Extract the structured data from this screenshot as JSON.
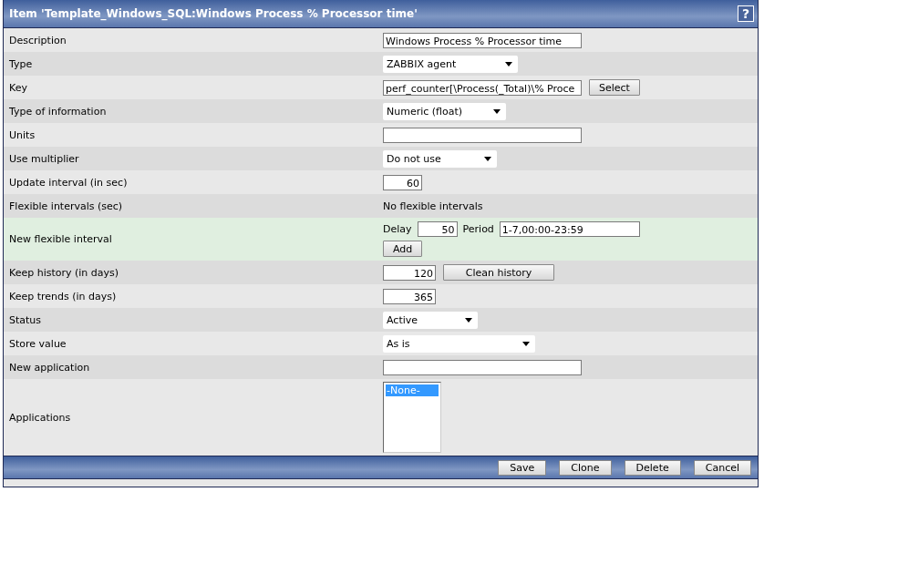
{
  "window": {
    "title": "Item 'Template_Windows_SQL:Windows Process % Processor time'",
    "help": "?"
  },
  "rows": [
    {
      "kind": "text",
      "label": "Description",
      "value": "Windows Process % Processor time"
    },
    {
      "kind": "select",
      "label": "Type",
      "value": "ZABBIX agent"
    },
    {
      "kind": "text",
      "label": "Key",
      "value": "perf_counter[\\Process(_Total)\\% Proce",
      "button": "Select"
    },
    {
      "kind": "select",
      "label": "Type of information",
      "value": "Numeric (float)"
    },
    {
      "kind": "text",
      "label": "Units",
      "value": ""
    },
    {
      "kind": "select",
      "label": "Use multiplier",
      "value": "Do not use"
    },
    {
      "kind": "number",
      "label": "Update interval (in sec)",
      "value": "60"
    },
    {
      "kind": "plain",
      "label": "Flexible intervals (sec)",
      "value": "No flexible intervals"
    },
    {
      "kind": "flex",
      "label": "New flexible interval",
      "delay_label": "Delay",
      "delay": "50",
      "period_label": "Period",
      "period": "1-7,00:00-23:59",
      "button": "Add"
    },
    {
      "kind": "number",
      "label": "Keep history (in days)",
      "value": "120",
      "button": "Clean history"
    },
    {
      "kind": "number",
      "label": "Keep trends (in days)",
      "value": "365"
    },
    {
      "kind": "select",
      "label": "Status",
      "value": "Active"
    },
    {
      "kind": "select",
      "label": "Store value",
      "value": "As is"
    },
    {
      "kind": "text",
      "label": "New application",
      "value": ""
    },
    {
      "kind": "listbox",
      "label": "Applications",
      "options": [
        {
          "label": "-None-",
          "selected": true
        }
      ]
    }
  ],
  "footer_buttons": [
    "Save",
    "Clone",
    "Delete",
    "Cancel"
  ]
}
